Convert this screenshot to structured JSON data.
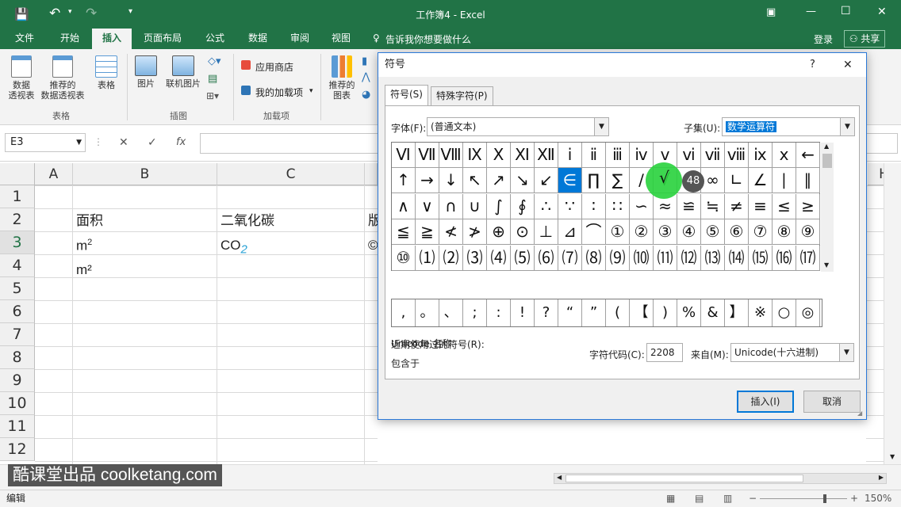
{
  "titlebar": {
    "title": "工作簿4 - Excel",
    "minimize": "—",
    "restore": "☐",
    "close": "✕",
    "ribbon_opts": "▣"
  },
  "tabs": [
    {
      "label": "文件",
      "x": 0
    },
    {
      "label": "开始"
    },
    {
      "label": "插入"
    },
    {
      "label": "页面布局"
    },
    {
      "label": "公式"
    },
    {
      "label": "数据"
    },
    {
      "label": "审阅"
    },
    {
      "label": "视图"
    }
  ],
  "tellme": "告诉我你想要做什么",
  "login": "登录",
  "share": "共享",
  "ribbon": {
    "pivot": "数据\n透视表",
    "recommended_pivot": "推荐的\n数据透视表",
    "table": "表格",
    "group_tables": "表格",
    "picture": "图片",
    "online_picture": "联机图片",
    "group_illustrations": "插图",
    "store": "应用商店",
    "my_addins": "我的加载项",
    "group_addins": "加载项",
    "recommended_charts": "推荐的\n图表"
  },
  "formulabar": {
    "namebox": "E3",
    "cancel": "✕",
    "enter": "✓",
    "fx": "fx"
  },
  "sheet": {
    "columns": [
      "A",
      "B",
      "C",
      "H"
    ],
    "rows": [
      "1",
      "2",
      "3",
      "4",
      "5",
      "6",
      "7",
      "8",
      "9",
      "10",
      "11",
      "12"
    ],
    "cells": {
      "B2": "面积",
      "C2": "二氧化碳",
      "D2": "版",
      "B3_base": "m",
      "B3_sup": "2",
      "C3_base": "CO",
      "C3_sub": "2",
      "D3": "©",
      "B4": "m²"
    }
  },
  "watermark": "酷课堂出品 coolketang.com",
  "status": {
    "mode": "编辑",
    "zoom": "150%"
  },
  "dialog": {
    "title": "符号",
    "help": "?",
    "close": "✕",
    "tab_symbols": "符号(S)",
    "tab_special": "特殊字符(P)",
    "font_label": "字体(F):",
    "font_value": "(普通文本)",
    "subset_label": "子集(U):",
    "subset_value": "数学运算符",
    "symbols": [
      "Ⅵ",
      "Ⅶ",
      "Ⅷ",
      "Ⅸ",
      "Ⅹ",
      "Ⅺ",
      "Ⅻ",
      "ⅰ",
      "ⅱ",
      "ⅲ",
      "ⅳ",
      "ⅴ",
      "ⅵ",
      "ⅶ",
      "ⅷ",
      "ⅸ",
      "ⅹ",
      "←",
      "↑",
      "→",
      "↓",
      "↖",
      "↗",
      "↘",
      "↙",
      "∈",
      "∏",
      "∑",
      "∕",
      "√",
      "∝",
      "∞",
      "∟",
      "∠",
      "∣",
      "∥",
      "∧",
      "∨",
      "∩",
      "∪",
      "∫",
      "∮",
      "∴",
      "∵",
      "∶",
      "∷",
      "∽",
      "≈",
      "≌",
      "≒",
      "≠",
      "≡",
      "≤",
      "≥",
      "≦",
      "≧",
      "≮",
      "≯",
      "⊕",
      "⊙",
      "⊥",
      "⊿",
      "⌒",
      "①",
      "②",
      "③",
      "④",
      "⑤",
      "⑥",
      "⑦",
      "⑧",
      "⑨",
      "⑩",
      "⑴",
      "⑵",
      "⑶",
      "⑷",
      "⑸",
      "⑹",
      "⑺",
      "⑻",
      "⑼",
      "⑽",
      "⑾",
      "⑿",
      "⒀",
      "⒁",
      "⒂",
      "⒃",
      "⒄"
    ],
    "selected_index": 25,
    "recent_label": "近期使用过的符号(R):",
    "recent": [
      ",",
      "。",
      "、",
      ";",
      ":",
      "!",
      "?",
      "“",
      "”",
      "(",
      "【",
      ")",
      "%",
      "&",
      "】",
      "※",
      "○",
      "◎"
    ],
    "unicode_name_label": "Unicode 名称:",
    "contains_label": "包含于",
    "char_code_label": "字符代码(C):",
    "char_code_value": "2208",
    "from_label": "来自(M):",
    "from_value": "Unicode(十六进制)",
    "insert_btn": "插入(I)",
    "cancel_btn": "取消",
    "cursor_badge": "48"
  }
}
